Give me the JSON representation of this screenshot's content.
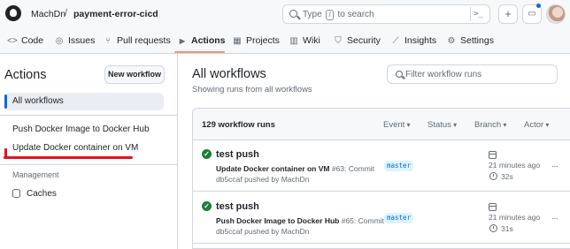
{
  "header": {
    "owner": "MachDn",
    "repo": "payment-error-cicd",
    "search_prefix": "Type",
    "search_key": "/",
    "search_suffix": "to search",
    "command_glyph": ">_",
    "plus_glyph": "+",
    "inbox_glyph": "▭"
  },
  "nav": {
    "items": [
      {
        "label": "Code",
        "icon": "code-icon",
        "glyph": "<>"
      },
      {
        "label": "Issues",
        "icon": "issue-icon",
        "glyph": "◎"
      },
      {
        "label": "Pull requests",
        "icon": "pull-request-icon",
        "glyph": "⑂"
      },
      {
        "label": "Actions",
        "icon": "play-icon",
        "glyph": "▶"
      },
      {
        "label": "Projects",
        "icon": "table-icon",
        "glyph": "▦"
      },
      {
        "label": "Wiki",
        "icon": "book-icon",
        "glyph": "▥"
      },
      {
        "label": "Security",
        "icon": "shield-icon",
        "glyph": "⛉"
      },
      {
        "label": "Insights",
        "icon": "graph-icon",
        "glyph": "⟋"
      },
      {
        "label": "Settings",
        "icon": "gear-icon",
        "glyph": "⚙"
      }
    ],
    "active": "Actions",
    "accent": "#fd8c73"
  },
  "sidebar": {
    "title": "Actions",
    "new_workflow": "New workflow",
    "all_workflows": "All workflows",
    "workflows": [
      "Push Docker Image to Docker Hub",
      "Update Docker container on VM"
    ],
    "management_heading": "Management",
    "caches": "Caches"
  },
  "main": {
    "title": "All workflows",
    "subtitle": "Showing runs from all workflows",
    "filter_placeholder": "Filter workflow runs",
    "run_count": "129 workflow runs",
    "filters": [
      "Event",
      "Status",
      "Branch",
      "Actor"
    ],
    "runs": [
      {
        "title": "test push",
        "workflow": "Update Docker container on VM",
        "detail": "#63: Commit",
        "commit_line": "db5ccaf pushed by MachDn",
        "branch": "master",
        "when": "21 minutes ago",
        "duration": "32s",
        "status": "success"
      },
      {
        "title": "test push",
        "workflow": "Push Docker Image to Docker Hub",
        "detail": "#65: Commit",
        "commit_line": "db5ccaf pushed by MachDn",
        "branch": "master",
        "when": "21 minutes ago",
        "duration": "31s",
        "status": "success"
      }
    ]
  },
  "colors": {
    "success": "#1a7f37",
    "link": "#0969da",
    "annotation_red": "#e0141e"
  }
}
